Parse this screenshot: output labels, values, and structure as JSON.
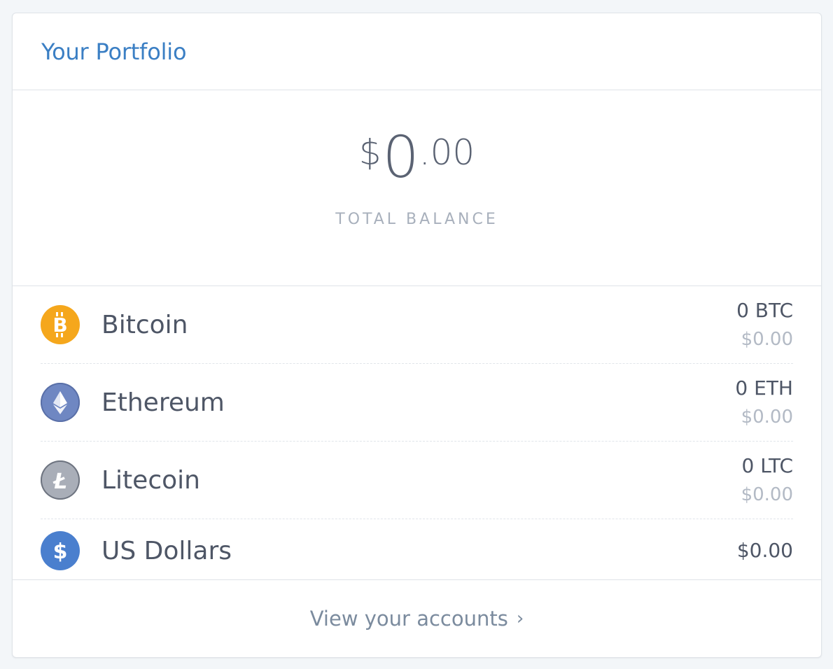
{
  "header": {
    "title": "Your Portfolio"
  },
  "balance": {
    "currency_symbol": "$",
    "whole": "0",
    "cents": ".00",
    "label": "TOTAL BALANCE"
  },
  "accounts": [
    {
      "name": "Bitcoin",
      "icon": "bitcoin-icon",
      "icon_color": "#f5a71c",
      "amount": "0 BTC",
      "fiat": "$0.00"
    },
    {
      "name": "Ethereum",
      "icon": "ethereum-icon",
      "icon_color": "#6f87c2",
      "amount": "0 ETH",
      "fiat": "$0.00"
    },
    {
      "name": "Litecoin",
      "icon": "litecoin-icon",
      "icon_color": "#a9aeb8",
      "amount": "0 LTC",
      "fiat": "$0.00"
    },
    {
      "name": "US Dollars",
      "icon": "dollar-icon",
      "icon_color": "#4a7fce",
      "amount": "$0.00"
    }
  ],
  "footer": {
    "link_label": "View your accounts",
    "chevron": "›"
  }
}
